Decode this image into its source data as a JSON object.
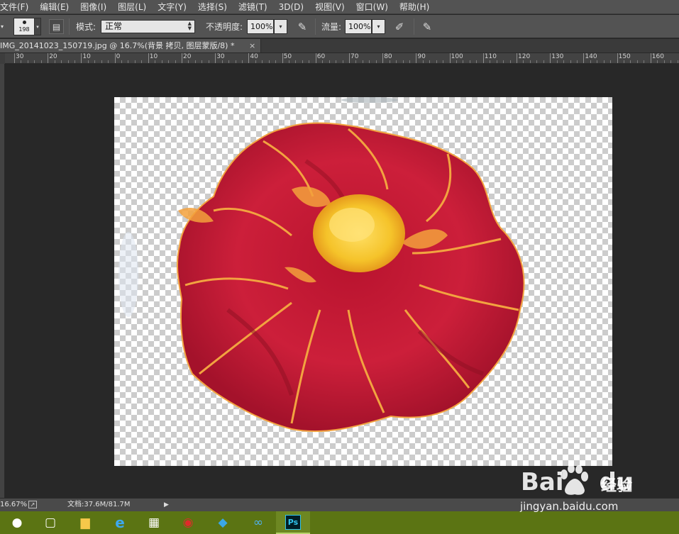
{
  "menu": {
    "items": [
      "文件(F)",
      "编辑(E)",
      "图像(I)",
      "图层(L)",
      "文字(Y)",
      "选择(S)",
      "滤镜(T)",
      "3D(D)",
      "视图(V)",
      "窗口(W)",
      "帮助(H)"
    ]
  },
  "options": {
    "brush_size": "198",
    "mode_label": "模式:",
    "mode_value": "正常",
    "opacity_label": "不透明度:",
    "opacity_value": "100%",
    "flow_label": "流量:",
    "flow_value": "100%"
  },
  "document": {
    "tab_title": "IMG_20141023_150719.jpg @ 16.7%(背景 拷贝, 图层蒙版/8) *",
    "close_glyph": "×"
  },
  "ruler": {
    "labels": [
      "30",
      "20",
      "10",
      "0",
      "10",
      "20",
      "30",
      "40",
      "50",
      "60",
      "70",
      "80",
      "90",
      "100",
      "110",
      "120",
      "130",
      "140",
      "150",
      "160"
    ]
  },
  "status": {
    "zoom": "16.67%",
    "doc_size": "文档:37.6M/81.7M",
    "arrow": "▶"
  },
  "taskbar": {
    "items": [
      {
        "name": "chat-icon",
        "glyph": "●"
      },
      {
        "name": "task-view-icon",
        "glyph": "▢"
      },
      {
        "name": "file-explorer-icon",
        "glyph": "▆"
      },
      {
        "name": "edge-browser-icon",
        "glyph": "e"
      },
      {
        "name": "store-icon",
        "glyph": "▦"
      },
      {
        "name": "netease-music-icon",
        "glyph": "◉"
      },
      {
        "name": "bird-app-icon",
        "glyph": "◆"
      },
      {
        "name": "cloud-sync-icon",
        "glyph": "∞"
      }
    ],
    "ps_label": "Ps"
  },
  "watermark": {
    "brand": "Bai",
    "brand_suffix": "du",
    "jingyan": "经验",
    "url": "jingyan.baidu.com"
  },
  "colors": {
    "petal": "#c81d37",
    "petal_dark": "#8e0f22",
    "petal_edge": "#f3a13c",
    "center": "#f5c62a",
    "taskbar": "#5b7413"
  }
}
